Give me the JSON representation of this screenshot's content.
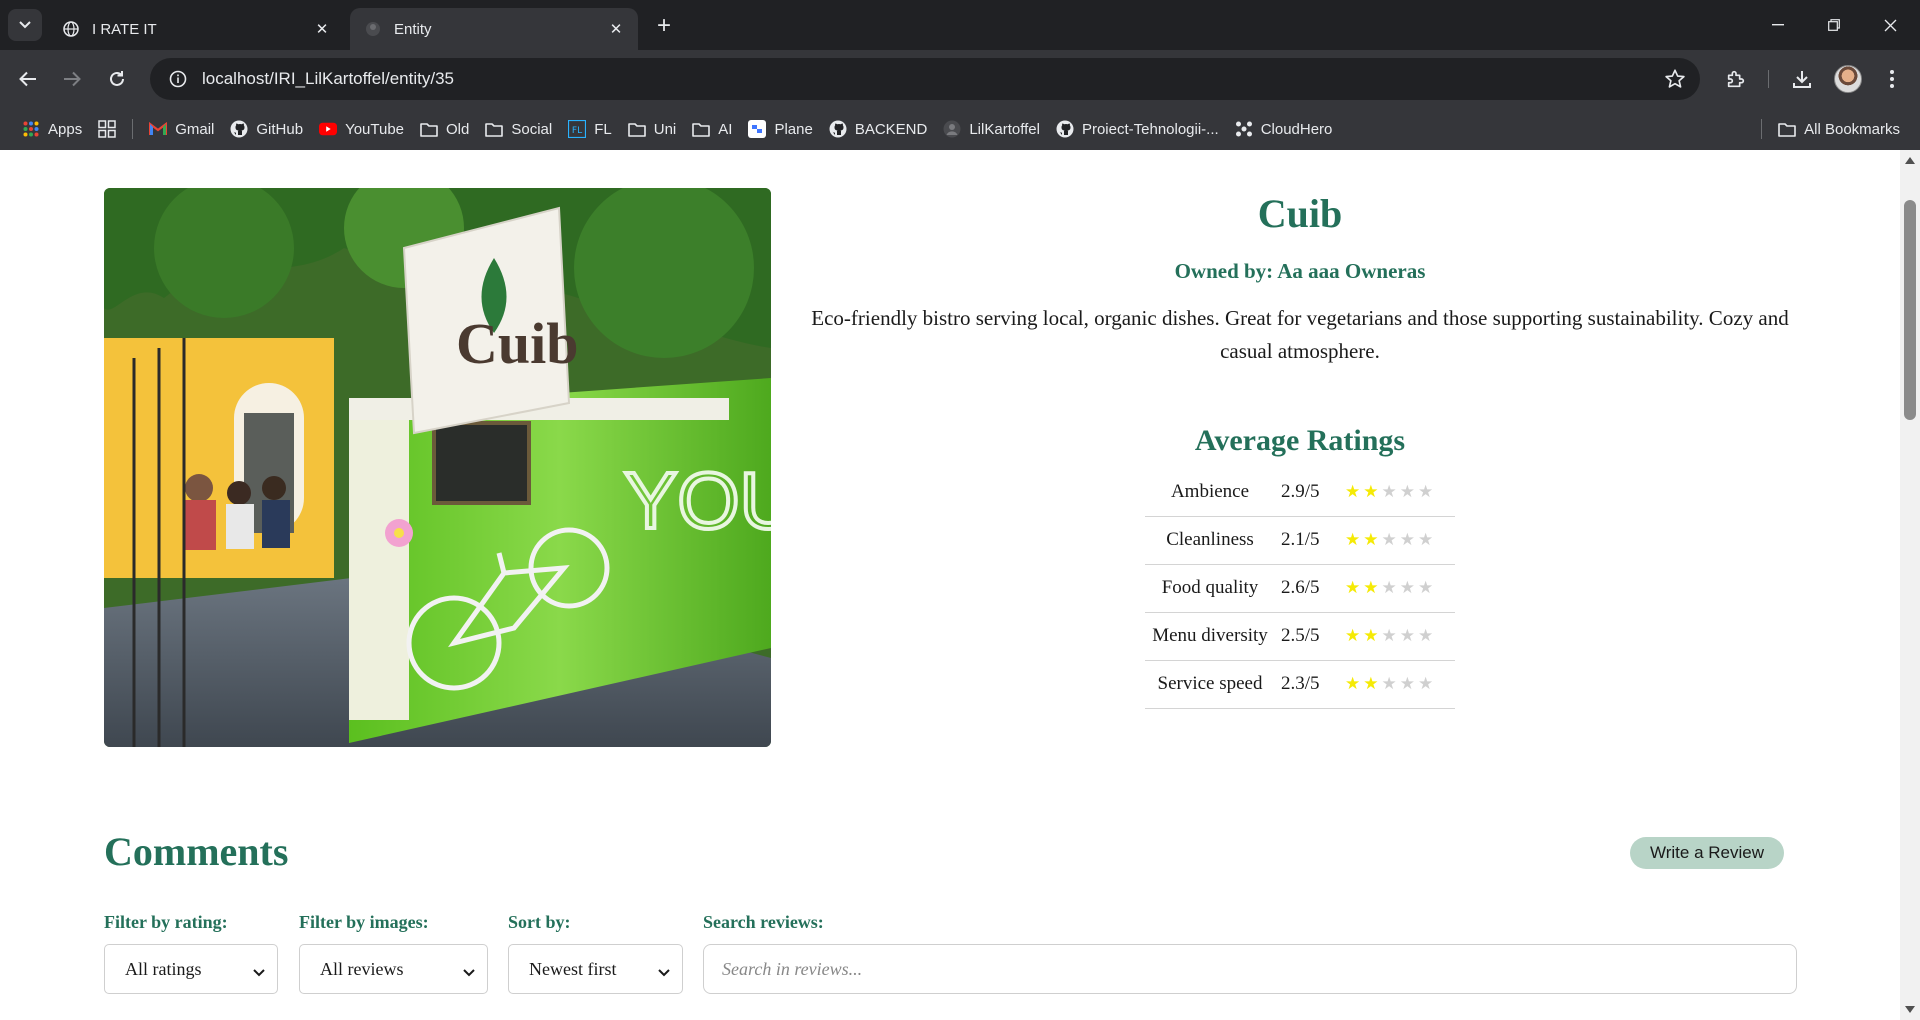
{
  "browser": {
    "tabs": [
      {
        "title": "I RATE IT",
        "active": false
      },
      {
        "title": "Entity",
        "active": true
      }
    ],
    "url": "localhost/IRI_LilKartoffel/entity/35",
    "bookmarks": [
      {
        "label": "Apps",
        "icon": "apps-grid-icon"
      },
      {
        "label": "Gmail",
        "icon": "gmail-icon"
      },
      {
        "label": "GitHub",
        "icon": "github-icon"
      },
      {
        "label": "YouTube",
        "icon": "youtube-icon"
      },
      {
        "label": "Old",
        "icon": "folder-icon"
      },
      {
        "label": "Social",
        "icon": "folder-icon"
      },
      {
        "label": "FL",
        "icon": "fl-icon"
      },
      {
        "label": "Uni",
        "icon": "folder-icon"
      },
      {
        "label": "AI",
        "icon": "folder-icon"
      },
      {
        "label": "Plane",
        "icon": "plane-app-icon"
      },
      {
        "label": "BACKEND",
        "icon": "github-icon"
      },
      {
        "label": "LilKartoffel",
        "icon": "user-icon"
      },
      {
        "label": "Proiect-Tehnologii-...",
        "icon": "github-icon"
      },
      {
        "label": "CloudHero",
        "icon": "cloudhero-icon"
      }
    ],
    "all_bookmarks": "All Bookmarks"
  },
  "entity": {
    "name": "Cuib",
    "owner": "Owned by: Aa aaa Owneras",
    "description": "Eco-friendly bistro serving local, organic dishes. Great for vegetarians and those supporting sustainability. Cozy and casual atmosphere.",
    "image_sign_text": "Cuib"
  },
  "ratings": {
    "title": "Average Ratings",
    "items": [
      {
        "name": "Ambience",
        "value": "2.9/5",
        "stars": 2
      },
      {
        "name": "Cleanliness",
        "value": "2.1/5",
        "stars": 2
      },
      {
        "name": "Food quality",
        "value": "2.6/5",
        "stars": 2
      },
      {
        "name": "Menu diversity",
        "value": "2.5/5",
        "stars": 2
      },
      {
        "name": "Service speed",
        "value": "2.3/5",
        "stars": 2
      }
    ]
  },
  "comments": {
    "title": "Comments",
    "write_review": "Write a Review",
    "filters": {
      "rating_label": "Filter by rating:",
      "rating_value": "All ratings",
      "images_label": "Filter by images:",
      "images_value": "All reviews",
      "sort_label": "Sort by:",
      "sort_value": "Newest first",
      "search_label": "Search reviews:",
      "search_placeholder": "Search in reviews..."
    }
  },
  "colors": {
    "accent": "#24705a",
    "button_bg": "#b8d4c7",
    "star_on": "#f5ea05",
    "star_off": "#d0d0d0"
  }
}
